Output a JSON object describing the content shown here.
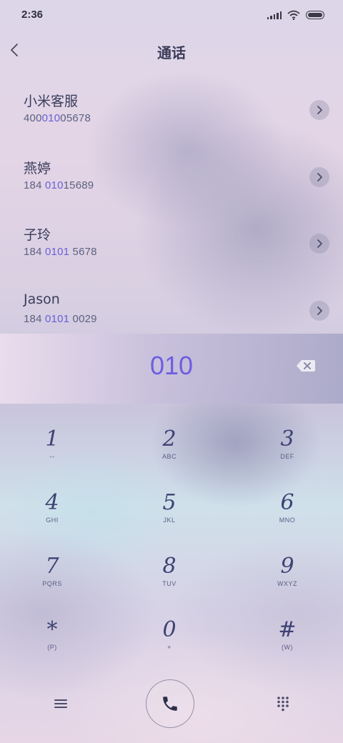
{
  "status": {
    "time": "2:36"
  },
  "header": {
    "title": "通话"
  },
  "contacts": [
    {
      "name": "小米客服",
      "number_pre": "400",
      "number_hl": "010",
      "number_post": "05678"
    },
    {
      "name": "燕婷",
      "number_pre": "184 ",
      "number_hl": "010",
      "number_post": "15689"
    },
    {
      "name": "子玲",
      "number_pre": "184 ",
      "number_hl": "0101",
      "number_post": " 5678"
    },
    {
      "name": "Jason",
      "number_pre": "184 ",
      "number_hl": "0101",
      "number_post": " 0029"
    }
  ],
  "input": {
    "dialed": "010"
  },
  "keypad": {
    "keys": [
      {
        "digit": "1",
        "letters": "◦◦"
      },
      {
        "digit": "2",
        "letters": "ABC"
      },
      {
        "digit": "3",
        "letters": "DEF"
      },
      {
        "digit": "4",
        "letters": "GHI"
      },
      {
        "digit": "5",
        "letters": "JKL"
      },
      {
        "digit": "6",
        "letters": "MNO"
      },
      {
        "digit": "7",
        "letters": "PQRS"
      },
      {
        "digit": "8",
        "letters": "TUV"
      },
      {
        "digit": "9",
        "letters": "WXYZ"
      },
      {
        "digit": "*",
        "letters": "(P)"
      },
      {
        "digit": "0",
        "letters": "+"
      },
      {
        "digit": "#",
        "letters": "(W)"
      }
    ]
  },
  "icons": {
    "back": "back-arrow-icon",
    "chevron": "chevron-right-icon",
    "backspace": "backspace-icon",
    "menu": "menu-icon",
    "call": "phone-icon",
    "keypad": "dialpad-icon"
  },
  "colors": {
    "highlight": "#6a5fd6",
    "dialed": "#6d5ee0",
    "text": "#3a3d5c"
  }
}
